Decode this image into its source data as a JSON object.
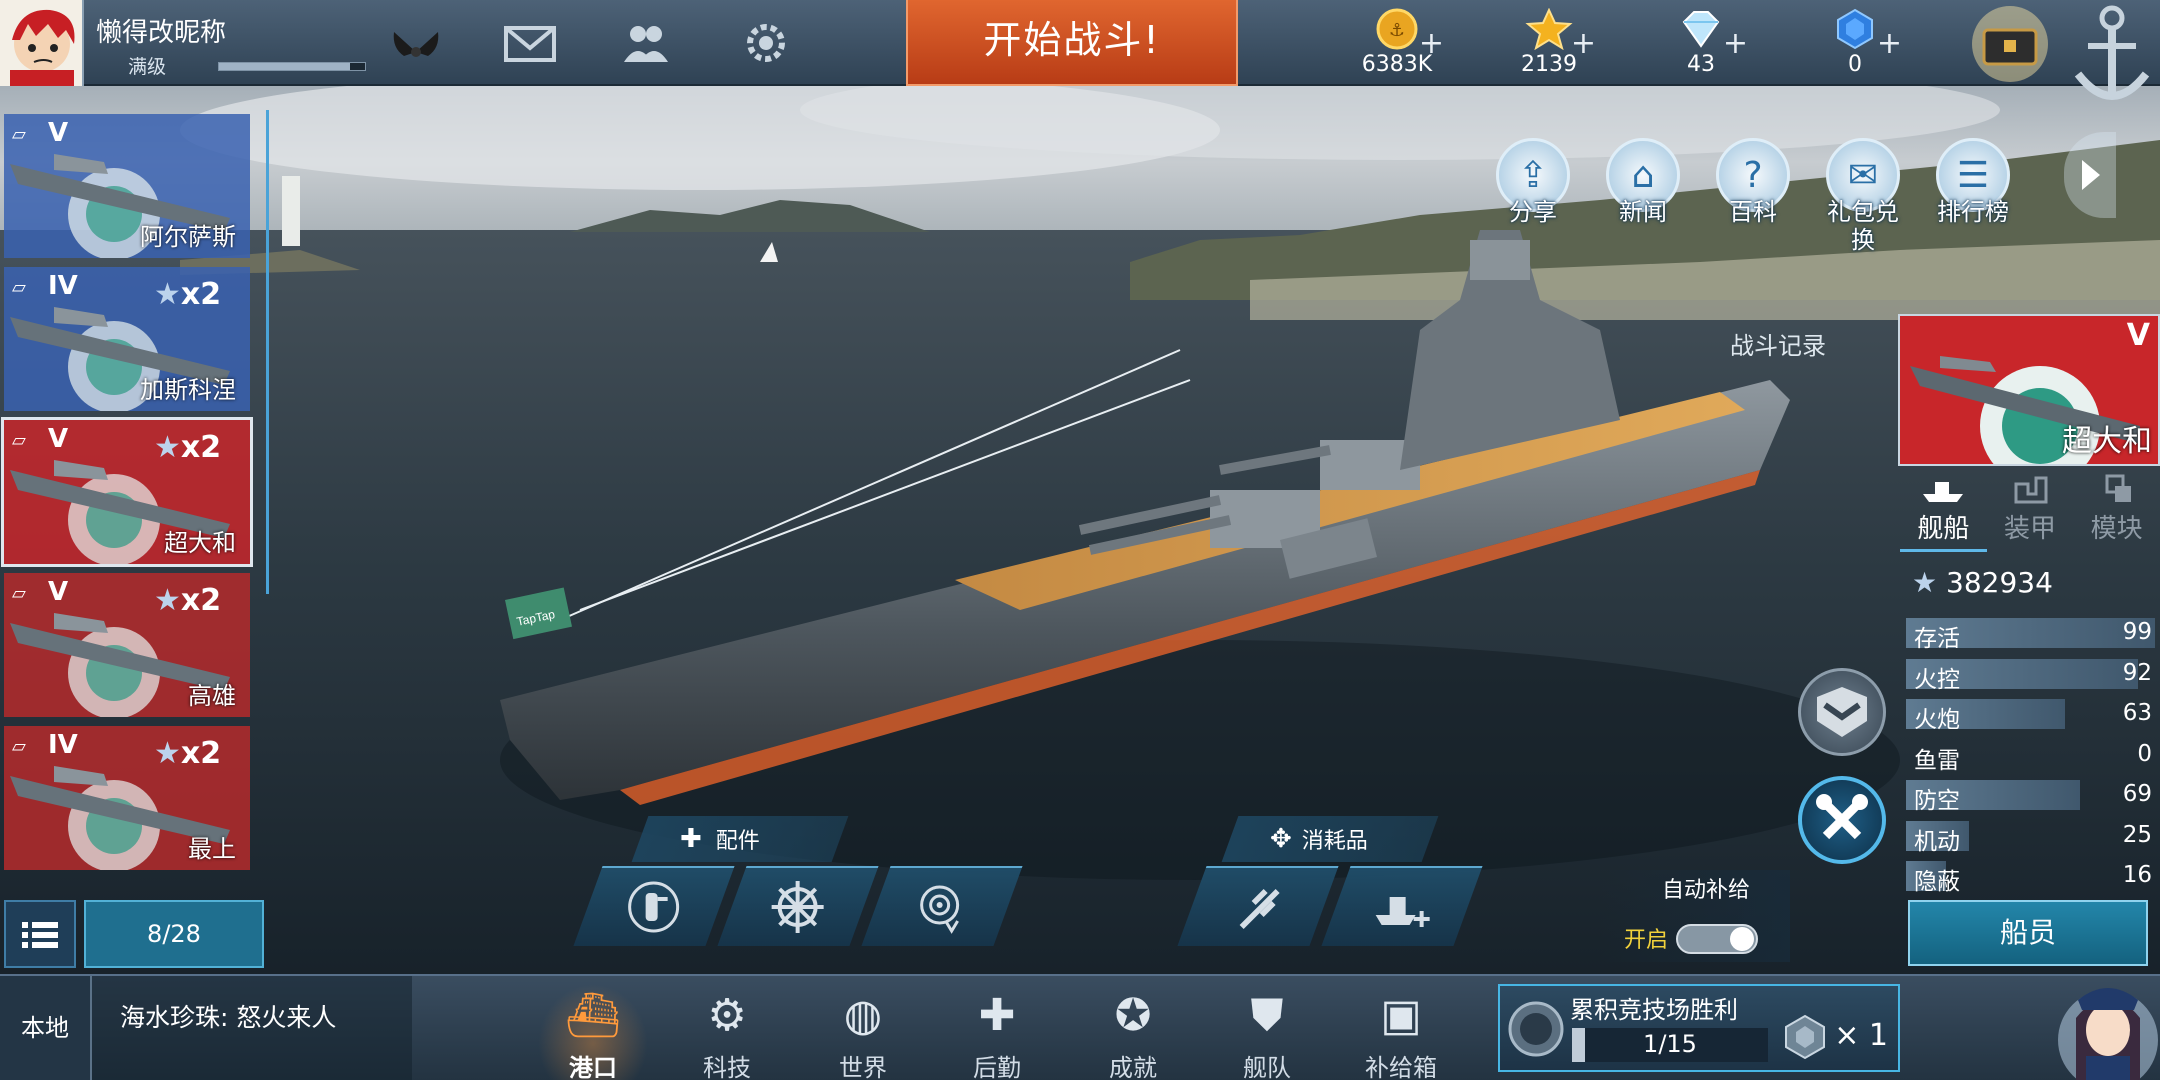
{
  "player": {
    "name": "懒得改昵称",
    "level_label": "满级",
    "xp_fraction": 0.9
  },
  "start_battle": "开始战斗!",
  "resources": [
    {
      "icon": "gold-coin-icon",
      "value": "6383K"
    },
    {
      "icon": "gold-star-icon",
      "value": "2139"
    },
    {
      "icon": "diamond-icon",
      "value": "43"
    },
    {
      "icon": "blue-gem-icon",
      "value": "0"
    }
  ],
  "quick_actions": [
    {
      "icon": "share-icon",
      "label": "分享"
    },
    {
      "icon": "news-icon",
      "label": "新闻"
    },
    {
      "icon": "wiki-icon",
      "label": "百科"
    },
    {
      "icon": "gift-exchange-icon",
      "label": "礼包兑换"
    },
    {
      "icon": "ranking-icon",
      "label": "排行榜"
    }
  ],
  "battle_log": "战斗记录",
  "fleet": [
    {
      "tier": "V",
      "stars": "",
      "name": "阿尔萨斯",
      "flag": "#3a62b0",
      "selected": false
    },
    {
      "tier": "IV",
      "stars": "x2",
      "name": "加斯科涅",
      "flag": "#3a62b0",
      "selected": false
    },
    {
      "tier": "V",
      "stars": "x2",
      "name": "超大和",
      "flag": "#c8262a",
      "selected": true
    },
    {
      "tier": "V",
      "stars": "x2",
      "name": "高雄",
      "flag": "#b52a2c",
      "selected": false
    },
    {
      "tier": "IV",
      "stars": "x2",
      "name": "最上",
      "flag": "#b52a2c",
      "selected": false
    }
  ],
  "fleet_count": "8/28",
  "selected_ship": {
    "tier": "V",
    "name": "超大和",
    "tabs": [
      "舰船",
      "装甲",
      "模块"
    ],
    "power": "382934",
    "stats": [
      {
        "label": "存活",
        "value": "99"
      },
      {
        "label": "火控",
        "value": "92"
      },
      {
        "label": "火炮",
        "value": "63"
      },
      {
        "label": "鱼雷",
        "value": "0"
      },
      {
        "label": "防空",
        "value": "69"
      },
      {
        "label": "机动",
        "value": "25"
      },
      {
        "label": "隐蔽",
        "value": "16"
      }
    ]
  },
  "crew_button": "船员",
  "parts_label": "配件",
  "consumables_label": "消耗品",
  "auto_supply": {
    "title": "自动补给",
    "state": "开启"
  },
  "ship_flag_text": "TapTap",
  "chat": {
    "channel": "本地",
    "message": "海水珍珠: 怒火来人"
  },
  "nav": [
    {
      "icon": "port-icon",
      "label": "港口",
      "active": true
    },
    {
      "icon": "tech-icon",
      "label": "科技",
      "active": false
    },
    {
      "icon": "world-icon",
      "label": "世界",
      "active": false
    },
    {
      "icon": "logistics-icon",
      "label": "后勤",
      "active": false
    },
    {
      "icon": "achievement-icon",
      "label": "成就",
      "active": false
    },
    {
      "icon": "fleet-icon",
      "label": "舰队",
      "active": false
    },
    {
      "icon": "supply-box-icon",
      "label": "补给箱",
      "active": false
    }
  ],
  "mission": {
    "title": "累积竞技场胜利",
    "progress": "1/15",
    "done": 1,
    "total": 15,
    "reward": "× 1"
  },
  "colors": {
    "accent": "#47b6e4",
    "start": "#d1521f",
    "highlight": "#f2d23b"
  }
}
